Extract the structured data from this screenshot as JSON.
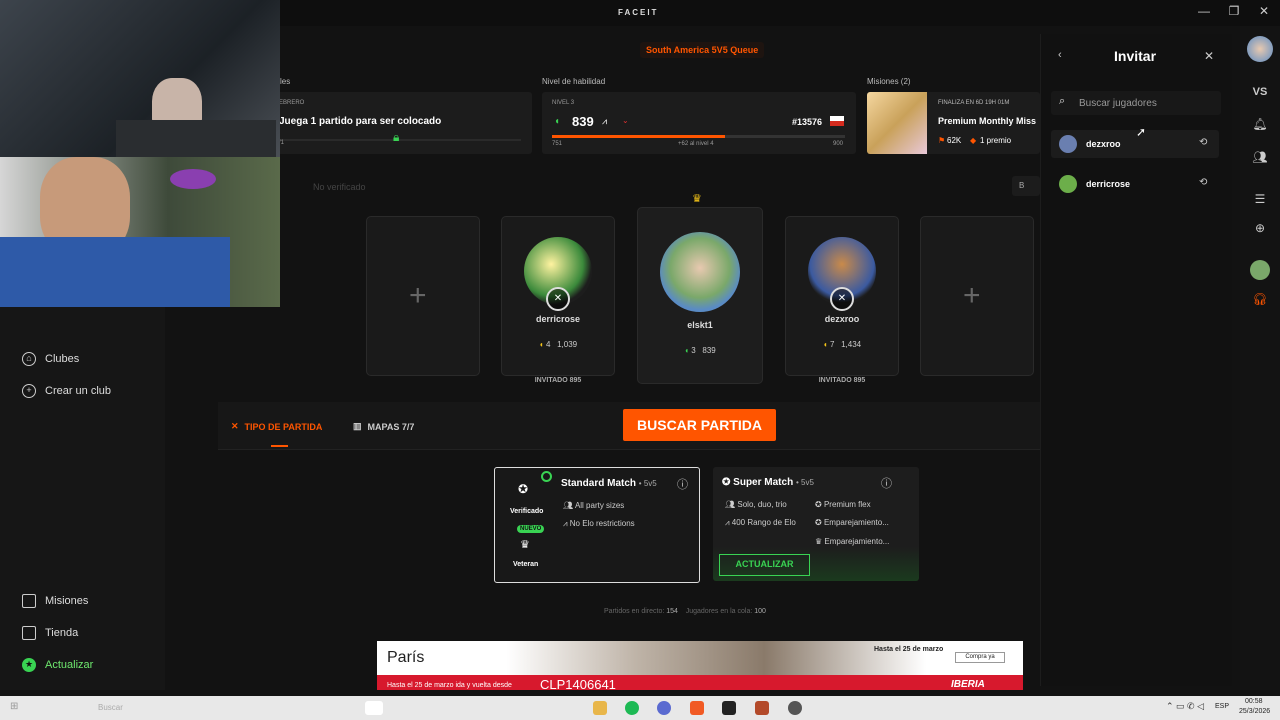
{
  "window": {
    "brand": "FACEIT",
    "controls": {
      "minimize": "—",
      "restore": "❐",
      "close": "✕"
    }
  },
  "queue": {
    "label": "South America 5V5 Queue"
  },
  "sections": {
    "left_label": "les",
    "skill_label": "Nivel de habilidad",
    "missions_label": "Misiones (2)"
  },
  "placement": {
    "month": "EBRERO",
    "text": "Juega 1 partido para ser colocado",
    "progress": "/1"
  },
  "skill": {
    "level": "NIVEL 3",
    "elo": "839",
    "rank": "#13576",
    "min": "751",
    "to_next": "+62 al nivel 4",
    "max": "900",
    "progress_fraction": 0.59
  },
  "mission": {
    "ends": "FINALIZA EN 6D 19H 01M",
    "title": "Premium Monthly Miss",
    "points": "62K",
    "prize": "1 premio"
  },
  "status": {
    "unverified": "No verificado",
    "side_btn": "B"
  },
  "party": {
    "players": [
      {
        "name": "derricrose",
        "level": "4",
        "elo": "1,039",
        "status": "INVITADO 895",
        "avatar": "cartoon-avatar"
      },
      {
        "name": "elskt1",
        "level": "3",
        "elo": "839",
        "status": "",
        "avatar": "anime-avatar",
        "leader": true
      },
      {
        "name": "dezxroo",
        "level": "7",
        "elo": "1,434",
        "status": "INVITADO 895",
        "avatar": "bear-avatar"
      }
    ]
  },
  "tabs": {
    "match_type": "TIPO DE PARTIDA",
    "maps": "MAPAS 7/7"
  },
  "search_button": "BUSCAR PARTIDA",
  "modes": {
    "standard": {
      "title": "Standard Match",
      "format": "• 5v5",
      "badge1": "Verificado",
      "new_badge": "NUEVO",
      "badge2": "Veteran",
      "features": [
        "All party sizes",
        "No Elo restrictions"
      ]
    },
    "super": {
      "title": "Super Match",
      "format": "• 5v5",
      "features_left": [
        "Solo, duo, trio",
        "400 Rango de Elo"
      ],
      "features_right": [
        "Premium flex",
        "Emparejamiento...",
        "Emparejamiento..."
      ],
      "upgrade": "ACTUALIZAR"
    }
  },
  "footer_stats": {
    "live_label": "Partidos en directo:",
    "live": "154",
    "queue_label": "Jugadores en la cola:",
    "queue": "100"
  },
  "left_nav": {
    "clubs": "Clubes",
    "create_club": "Crear un club",
    "missions": "Misiones",
    "shop": "Tienda",
    "upgrade": "Actualizar"
  },
  "ad": {
    "city": "París",
    "until": "Hasta el 25 de marzo",
    "cta": "Compra ya",
    "strip": "Hasta el 25 de marzo ida y vuelta desde",
    "price": "CLP1406641",
    "brand": "IBERIA"
  },
  "invite": {
    "title": "Invitar",
    "search_placeholder": "Buscar jugadores",
    "results": [
      {
        "name": "dezxroo"
      },
      {
        "name": "derricrose"
      }
    ]
  },
  "rail": {
    "vs": "VS"
  },
  "taskbar": {
    "search": "Buscar",
    "lang": "ESP",
    "time": "00:58",
    "date": "25/3/2026"
  },
  "colors": {
    "accent": "#ff5500",
    "green": "#39d353",
    "bg": "#121212"
  }
}
